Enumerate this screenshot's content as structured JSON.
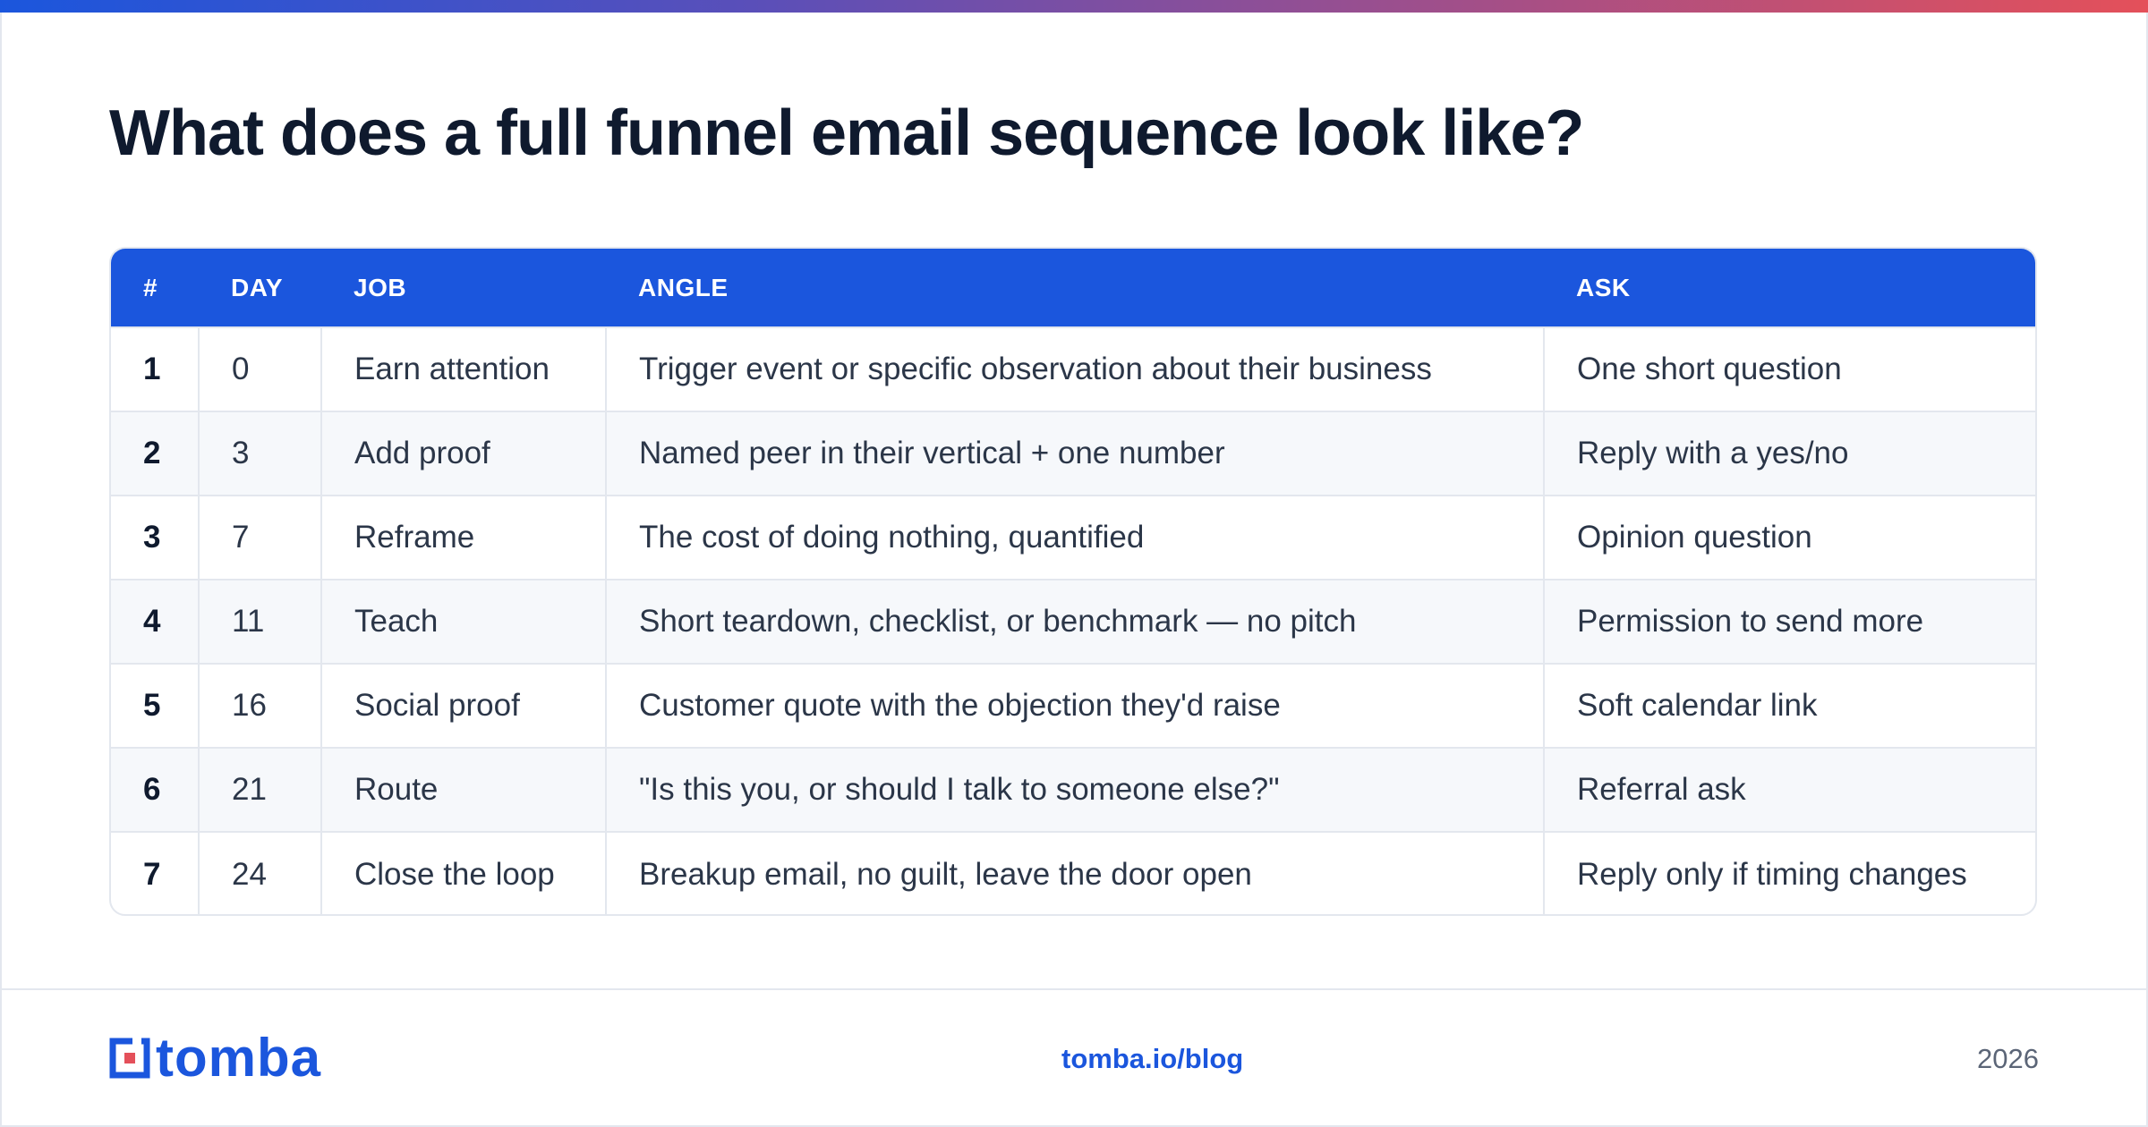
{
  "title": "What does a full funnel email sequence look like?",
  "table": {
    "headers": [
      "#",
      "DAY",
      "JOB",
      "ANGLE",
      "ASK"
    ],
    "rows": [
      [
        "1",
        "0",
        "Earn attention",
        "Trigger event or specific observation about their business",
        "One short question"
      ],
      [
        "2",
        "3",
        "Add proof",
        "Named peer in their vertical + one number",
        "Reply with a yes/no"
      ],
      [
        "3",
        "7",
        "Reframe",
        "The cost of doing nothing, quantified",
        "Opinion question"
      ],
      [
        "4",
        "11",
        "Teach",
        "Short teardown, checklist, or benchmark — no pitch",
        "Permission to send more"
      ],
      [
        "5",
        "16",
        "Social proof",
        "Customer quote with the objection they'd raise",
        "Soft calendar link"
      ],
      [
        "6",
        "21",
        "Route",
        "\"Is this you, or should I talk to someone else?\"",
        "Referral ask"
      ],
      [
        "7",
        "24",
        "Close the loop",
        "Breakup email, no guilt, leave the door open",
        "Reply only if timing changes"
      ]
    ]
  },
  "footer": {
    "brand": "tomba",
    "brand_icon": "tomba-logo-icon",
    "link": "tomba.io/blog",
    "year": "2026"
  },
  "colors": {
    "accent": "#1b56dd",
    "gradient_end": "#e4505a",
    "logo_red": "#e4505a"
  }
}
